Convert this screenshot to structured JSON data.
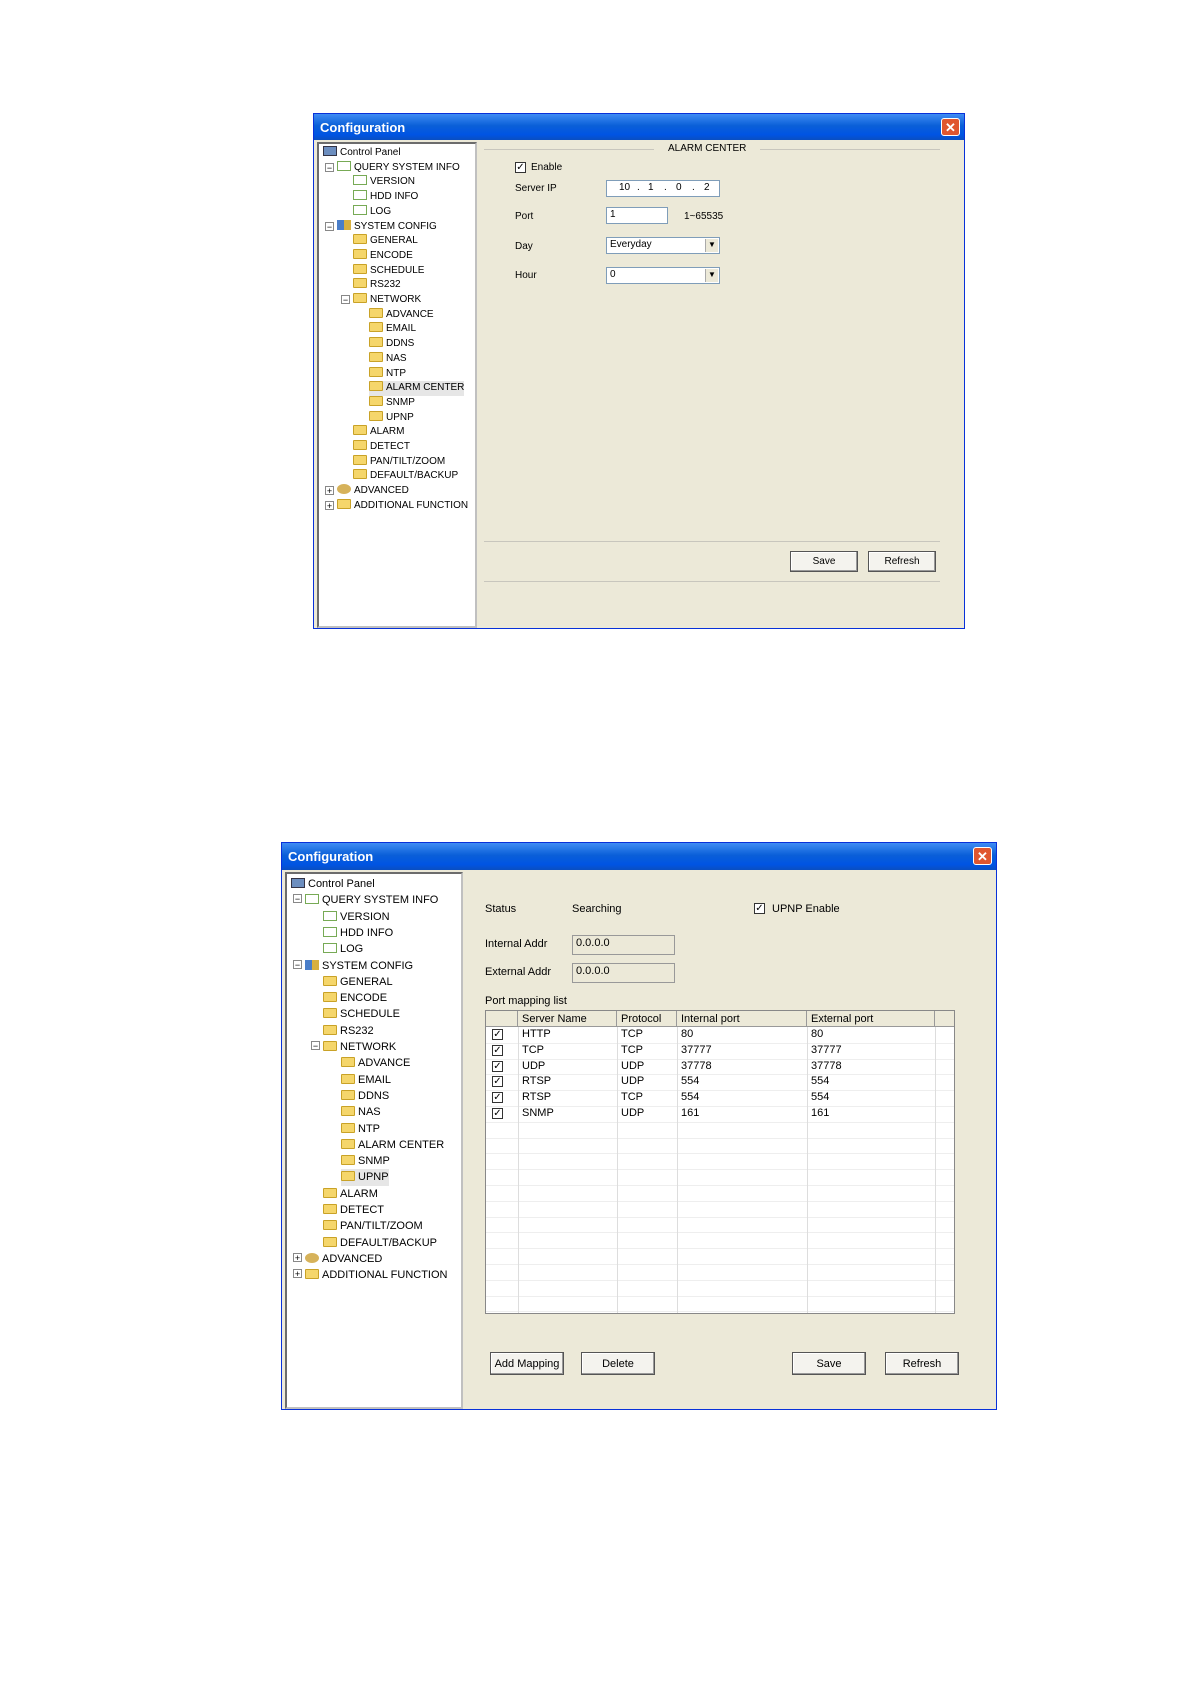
{
  "window1": {
    "title": "Configuration",
    "close_glyph": "✕",
    "tree": [
      {
        "label": "Control Panel",
        "level": 0,
        "icon": "computer-icon",
        "toggle": ""
      },
      {
        "label": "QUERY SYSTEM INFO",
        "level": 1,
        "icon": "notepad-icon",
        "toggle": "−"
      },
      {
        "label": "VERSION",
        "level": 2,
        "icon": "notepad-icon",
        "toggle": ""
      },
      {
        "label": "HDD INFO",
        "level": 2,
        "icon": "notepad-icon",
        "toggle": ""
      },
      {
        "label": "LOG",
        "level": 2,
        "icon": "notepad-icon",
        "toggle": ""
      },
      {
        "label": "SYSTEM CONFIG",
        "level": 1,
        "icon": "tools-icon",
        "toggle": "−"
      },
      {
        "label": "GENERAL",
        "level": 2,
        "icon": "folder-icon",
        "toggle": ""
      },
      {
        "label": "ENCODE",
        "level": 2,
        "icon": "folder-icon",
        "toggle": ""
      },
      {
        "label": "SCHEDULE",
        "level": 2,
        "icon": "folder-icon",
        "toggle": ""
      },
      {
        "label": "RS232",
        "level": 2,
        "icon": "folder-icon",
        "toggle": ""
      },
      {
        "label": "NETWORK",
        "level": 2,
        "icon": "folder-icon",
        "toggle": "−"
      },
      {
        "label": "ADVANCE",
        "level": 3,
        "icon": "folder-icon",
        "toggle": ""
      },
      {
        "label": "EMAIL",
        "level": 3,
        "icon": "folder-icon",
        "toggle": ""
      },
      {
        "label": "DDNS",
        "level": 3,
        "icon": "folder-icon",
        "toggle": ""
      },
      {
        "label": "NAS",
        "level": 3,
        "icon": "folder-icon",
        "toggle": ""
      },
      {
        "label": "NTP",
        "level": 3,
        "icon": "folder-icon",
        "toggle": ""
      },
      {
        "label": "ALARM CENTER",
        "level": 3,
        "icon": "folder-open-icon",
        "toggle": "",
        "selected": true
      },
      {
        "label": "SNMP",
        "level": 3,
        "icon": "folder-icon",
        "toggle": ""
      },
      {
        "label": "UPNP",
        "level": 3,
        "icon": "folder-icon",
        "toggle": ""
      },
      {
        "label": "ALARM",
        "level": 2,
        "icon": "folder-icon",
        "toggle": ""
      },
      {
        "label": "DETECT",
        "level": 2,
        "icon": "folder-icon",
        "toggle": ""
      },
      {
        "label": "PAN/TILT/ZOOM",
        "level": 2,
        "icon": "folder-icon",
        "toggle": ""
      },
      {
        "label": "DEFAULT/BACKUP",
        "level": 2,
        "icon": "folder-icon",
        "toggle": ""
      },
      {
        "label": "ADVANCED",
        "level": 1,
        "icon": "gears-icon",
        "toggle": "+"
      },
      {
        "label": "ADDITIONAL FUNCTION",
        "level": 1,
        "icon": "folder-icon",
        "toggle": "+"
      }
    ],
    "section_title": "ALARM CENTER",
    "enable_label": "Enable",
    "enable_checked": true,
    "server_ip_label": "Server IP",
    "server_ip": [
      "10",
      "1",
      "0",
      "2"
    ],
    "port_label": "Port",
    "port_value": "1",
    "port_range": "1~65535",
    "day_label": "Day",
    "day_value": "Everyday",
    "hour_label": "Hour",
    "hour_value": "0",
    "save_label": "Save",
    "refresh_label": "Refresh"
  },
  "window2": {
    "title": "Configuration",
    "close_glyph": "✕",
    "tree": [
      {
        "label": "Control Panel",
        "level": 0,
        "icon": "computer-icon",
        "toggle": ""
      },
      {
        "label": "QUERY SYSTEM INFO",
        "level": 1,
        "icon": "notepad-icon",
        "toggle": "−"
      },
      {
        "label": "VERSION",
        "level": 2,
        "icon": "notepad-icon",
        "toggle": ""
      },
      {
        "label": "HDD INFO",
        "level": 2,
        "icon": "notepad-icon",
        "toggle": ""
      },
      {
        "label": "LOG",
        "level": 2,
        "icon": "notepad-icon",
        "toggle": ""
      },
      {
        "label": "SYSTEM CONFIG",
        "level": 1,
        "icon": "tools-icon",
        "toggle": "−"
      },
      {
        "label": "GENERAL",
        "level": 2,
        "icon": "folder-icon",
        "toggle": ""
      },
      {
        "label": "ENCODE",
        "level": 2,
        "icon": "folder-icon",
        "toggle": ""
      },
      {
        "label": "SCHEDULE",
        "level": 2,
        "icon": "folder-icon",
        "toggle": ""
      },
      {
        "label": "RS232",
        "level": 2,
        "icon": "folder-icon",
        "toggle": ""
      },
      {
        "label": "NETWORK",
        "level": 2,
        "icon": "folder-icon",
        "toggle": "−"
      },
      {
        "label": "ADVANCE",
        "level": 3,
        "icon": "folder-icon",
        "toggle": ""
      },
      {
        "label": "EMAIL",
        "level": 3,
        "icon": "folder-icon",
        "toggle": ""
      },
      {
        "label": "DDNS",
        "level": 3,
        "icon": "folder-icon",
        "toggle": ""
      },
      {
        "label": "NAS",
        "level": 3,
        "icon": "folder-icon",
        "toggle": ""
      },
      {
        "label": "NTP",
        "level": 3,
        "icon": "folder-icon",
        "toggle": ""
      },
      {
        "label": "ALARM CENTER",
        "level": 3,
        "icon": "folder-icon",
        "toggle": ""
      },
      {
        "label": "SNMP",
        "level": 3,
        "icon": "folder-icon",
        "toggle": ""
      },
      {
        "label": "UPNP",
        "level": 3,
        "icon": "folder-open-icon",
        "toggle": "",
        "selected": true
      },
      {
        "label": "ALARM",
        "level": 2,
        "icon": "folder-icon",
        "toggle": ""
      },
      {
        "label": "DETECT",
        "level": 2,
        "icon": "folder-icon",
        "toggle": ""
      },
      {
        "label": "PAN/TILT/ZOOM",
        "level": 2,
        "icon": "folder-icon",
        "toggle": ""
      },
      {
        "label": "DEFAULT/BACKUP",
        "level": 2,
        "icon": "folder-icon",
        "toggle": ""
      },
      {
        "label": "ADVANCED",
        "level": 1,
        "icon": "gears-icon",
        "toggle": "+"
      },
      {
        "label": "ADDITIONAL FUNCTION",
        "level": 1,
        "icon": "folder-icon",
        "toggle": "+"
      }
    ],
    "status_label": "Status",
    "status_value": "Searching",
    "upnp_enable_label": "UPNP Enable",
    "upnp_checked": true,
    "internal_addr_label": "Internal Addr",
    "internal_addr": "0.0.0.0",
    "external_addr_label": "External Addr",
    "external_addr": "0.0.0.0",
    "port_mapping_label": "Port mapping list",
    "columns": [
      "Server Name",
      "Protocol",
      "Internal port",
      "External port"
    ],
    "rows": [
      {
        "checked": true,
        "name": "HTTP",
        "protocol": "TCP",
        "internal": "80",
        "external": "80"
      },
      {
        "checked": true,
        "name": "TCP",
        "protocol": "TCP",
        "internal": "37777",
        "external": "37777"
      },
      {
        "checked": true,
        "name": "UDP",
        "protocol": "UDP",
        "internal": "37778",
        "external": "37778"
      },
      {
        "checked": true,
        "name": "RTSP",
        "protocol": "UDP",
        "internal": "554",
        "external": "554"
      },
      {
        "checked": true,
        "name": "RTSP",
        "protocol": "TCP",
        "internal": "554",
        "external": "554"
      },
      {
        "checked": true,
        "name": "SNMP",
        "protocol": "UDP",
        "internal": "161",
        "external": "161"
      }
    ],
    "add_mapping_label": "Add Mapping",
    "delete_label": "Delete",
    "save_label": "Save",
    "refresh_label": "Refresh"
  }
}
